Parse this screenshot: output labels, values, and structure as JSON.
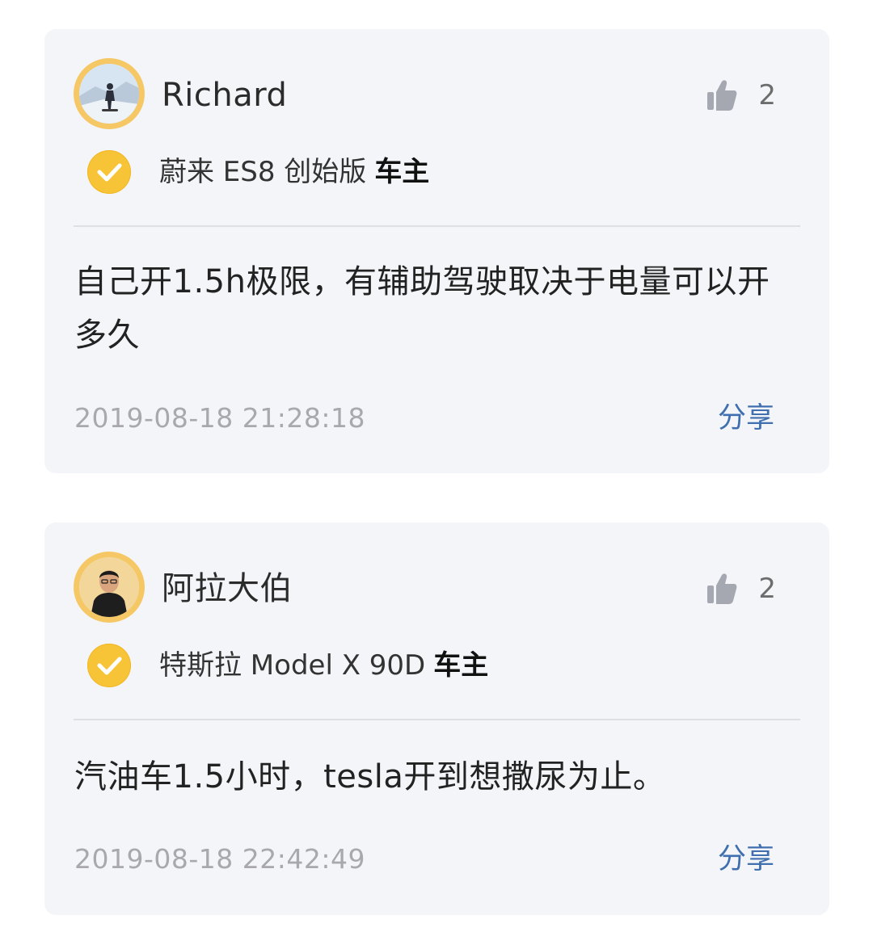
{
  "comments": [
    {
      "username": "Richard",
      "likes": "2",
      "owner_car": "蔚来 ES8 创始版",
      "owner_tag": "车主",
      "text": "自己开1.5h极限，有辅助驾驶取决于电量可以开多久",
      "timestamp": "2019-08-18 21:28:18",
      "share_label": "分享"
    },
    {
      "username": "阿拉大伯",
      "likes": "2",
      "owner_car": "特斯拉 Model X 90D",
      "owner_tag": "车主",
      "text": "汽油车1.5小时，tesla开到想撒尿为止。",
      "timestamp": "2019-08-18 22:42:49",
      "share_label": "分享"
    }
  ],
  "colors": {
    "card_background": "#f4f5f9",
    "badge": "#f8c437",
    "share_link": "#3f6fae",
    "timestamp": "#a9a9ad"
  },
  "icons": {
    "like": "thumbs-up-icon",
    "verified": "checkmark-badge-icon"
  }
}
